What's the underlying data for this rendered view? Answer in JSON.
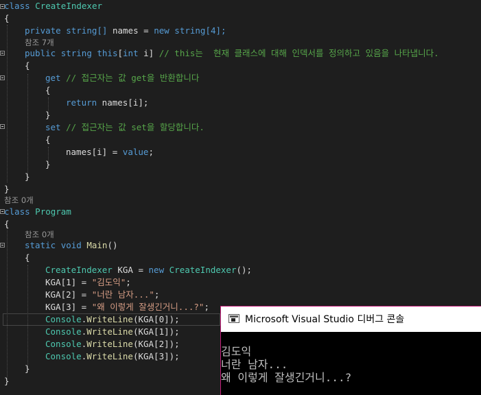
{
  "editor": {
    "class1": {
      "kw": "class",
      "name": "CreateIndexer",
      "open": "{",
      "close": "}"
    },
    "field": {
      "kw": "private",
      "type": "string[]",
      "name": "names",
      "eq": " = ",
      "new": "new",
      "init": "string[4];"
    },
    "codelens_indexer": "참조 7개",
    "indexer": {
      "public": "public",
      "string": "string",
      "this": "this",
      "br_open": "[",
      "int": "int",
      "param": " i",
      "br_close": "]",
      "comment": "// this는  현재 클래스에 대해 인덱서를 정의하고 있음을 나타냅니다."
    },
    "indexer_open": "{",
    "get": {
      "kw": "get",
      "comment": "// 접근자는 값 get을 반환합니다",
      "open": "{",
      "ret_kw": "return",
      "ret_expr": " names[i];",
      "close": "}"
    },
    "set": {
      "kw": "set",
      "comment": "// 접근자는 값 set을 할당합니다.",
      "open": "{",
      "assign": "names[i] = ",
      "value_kw": "value",
      "semi": ";",
      "close": "}"
    },
    "indexer_close": "}",
    "codelens_program": "참조 0개",
    "class2": {
      "kw": "class",
      "name": "Program",
      "open": "{",
      "close": "}"
    },
    "codelens_main": "참조 0개",
    "main": {
      "static": "static",
      "void": "void",
      "name": "Main",
      "parens": "()",
      "open": "{",
      "close": "}"
    },
    "body": {
      "line1": {
        "type": "CreateIndexer",
        "var": " KGA",
        "eq": " = ",
        "new": "new",
        "ctor": "CreateIndexer",
        "tail": "();"
      },
      "assign1": {
        "lhs": "KGA[1] = ",
        "str": "\"김도익\"",
        "semi": ";"
      },
      "assign2": {
        "lhs": "KGA[2] = ",
        "str": "\"너란 남자...\"",
        "semi": ";"
      },
      "assign3": {
        "lhs": "KGA[3] = ",
        "str": "\"왜 이렇게 잘생긴거니...?\"",
        "semi": ";"
      },
      "writes": [
        {
          "cls": "Console",
          "dot": ".",
          "method": "WriteLine",
          "arg": "(KGA[0]);"
        },
        {
          "cls": "Console",
          "dot": ".",
          "method": "WriteLine",
          "arg": "(KGA[1]);"
        },
        {
          "cls": "Console",
          "dot": ".",
          "method": "WriteLine",
          "arg": "(KGA[2]);"
        },
        {
          "cls": "Console",
          "dot": ".",
          "method": "WriteLine",
          "arg": "(KGA[3]);"
        }
      ]
    }
  },
  "console": {
    "title": "Microsoft Visual Studio 디버그 콘솔",
    "icon": "console-window-icon",
    "output": [
      "김도익",
      "너란 남자...",
      "왜 이렇게 잘생긴거니...?"
    ]
  },
  "colors": {
    "background": "#1e1e1e",
    "keyword": "#569cd6",
    "type": "#4ec9b0",
    "string": "#d69d85",
    "comment": "#57a64a",
    "method": "#dcdcaa",
    "console_border": "#c41e7a"
  }
}
